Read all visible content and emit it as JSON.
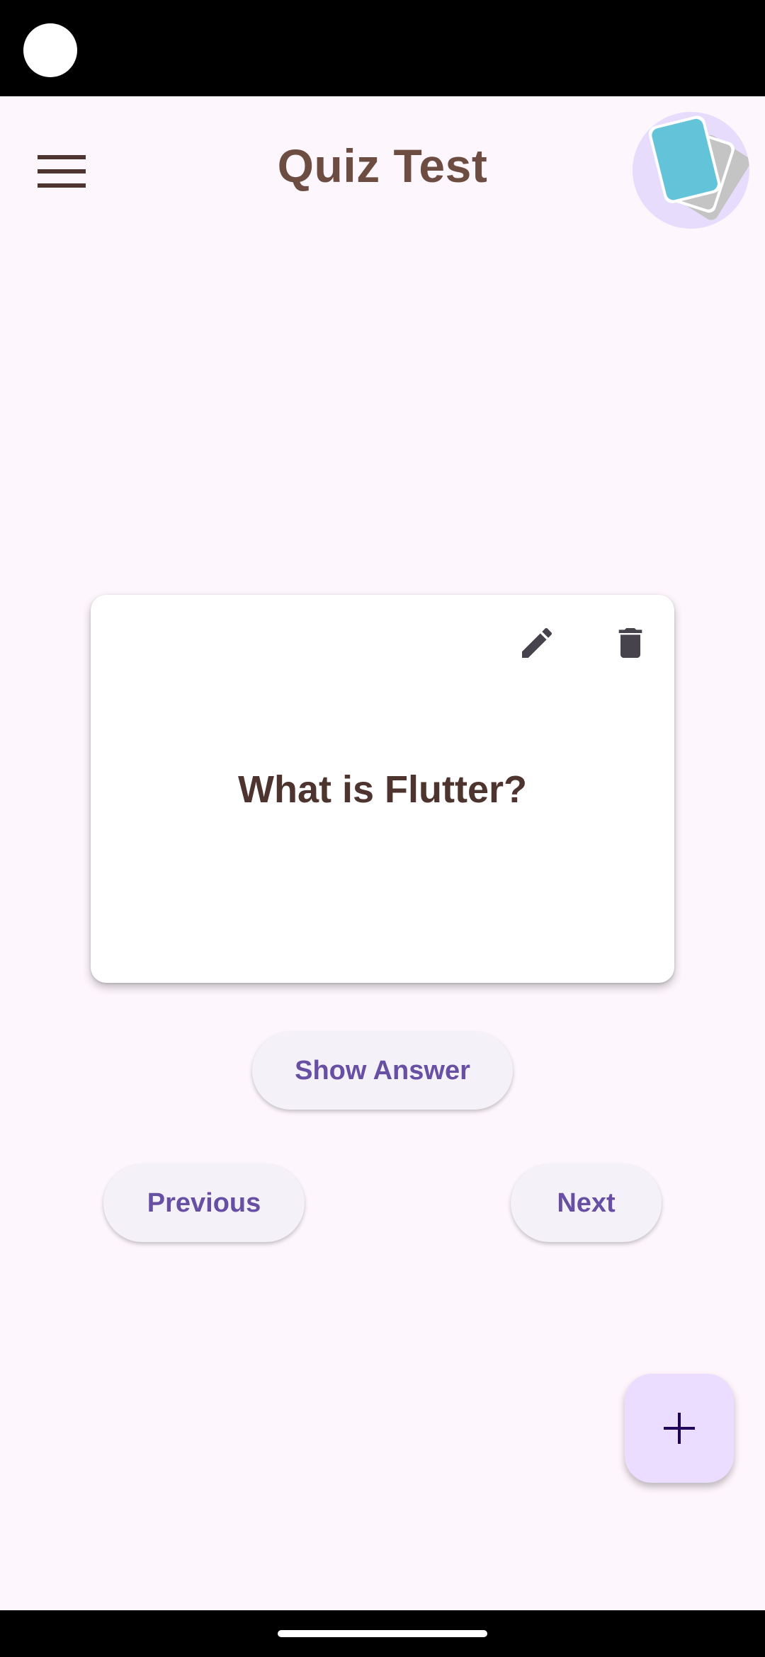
{
  "app_bar": {
    "title": "Quiz Test",
    "menu_icon": "hamburger-menu-icon",
    "logo_icon": "flashcards-logo-icon"
  },
  "card": {
    "question": "What is Flutter?",
    "edit_icon": "pencil-icon",
    "delete_icon": "trash-icon"
  },
  "actions": {
    "show_answer_label": "Show Answer",
    "previous_label": "Previous",
    "next_label": "Next"
  },
  "fab": {
    "icon": "plus-icon"
  },
  "colors": {
    "background": "#fdf6fc",
    "title": "#6d4c41",
    "question": "#4e342e",
    "accent": "#6750a4",
    "fab_background": "#eaddff"
  }
}
